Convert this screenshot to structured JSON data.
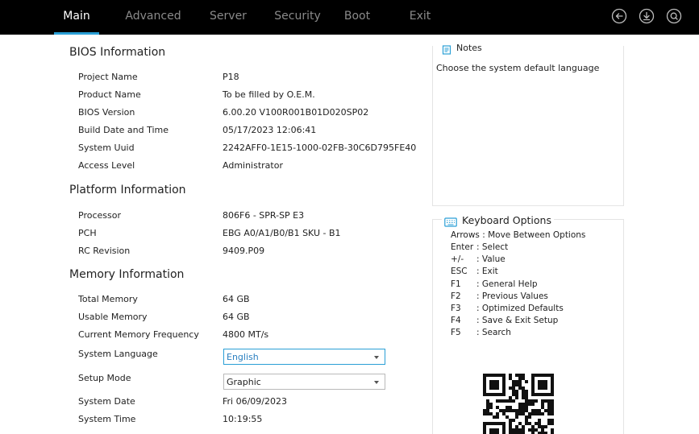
{
  "menu": {
    "tabs": [
      {
        "label": "Main",
        "active": true
      },
      {
        "label": "Advanced",
        "active": false
      },
      {
        "label": "Server",
        "active": false
      },
      {
        "label": "Security",
        "active": false
      },
      {
        "label": "Boot",
        "active": false
      },
      {
        "label": "Exit",
        "active": false
      }
    ],
    "icons": [
      "back-icon",
      "download-icon",
      "search-icon"
    ],
    "accent_color": "#2a9fd6"
  },
  "bios_info": {
    "title": "BIOS Information",
    "rows": [
      {
        "label": "Project Name",
        "value": "P18"
      },
      {
        "label": "Product Name",
        "value": "To be filled by O.E.M."
      },
      {
        "label": "BIOS Version",
        "value": "6.00.20 V100R001B01D020SP02"
      },
      {
        "label": "Build Date and Time",
        "value": "05/17/2023 12:06:41"
      },
      {
        "label": "System Uuid",
        "value": "2242AFF0-1E15-1000-02FB-30C6D795FE40"
      },
      {
        "label": "Access Level",
        "value": "Administrator"
      }
    ]
  },
  "platform_info": {
    "title": "Platform Information",
    "rows": [
      {
        "label": "Processor",
        "value": "806F6 - SPR-SP E3"
      },
      {
        "label": "PCH",
        "value": "EBG A0/A1/B0/B1 SKU - B1"
      },
      {
        "label": "RC Revision",
        "value": "9409.P09"
      }
    ]
  },
  "memory_info": {
    "title": "Memory Information",
    "rows": [
      {
        "label": "Total Memory",
        "value": "64 GB"
      },
      {
        "label": "Usable Memory",
        "value": "64 GB"
      },
      {
        "label": "Current Memory Frequency",
        "value": "4800 MT/s"
      }
    ]
  },
  "settings": {
    "system_language": {
      "label": "System Language",
      "value": "English"
    },
    "setup_mode": {
      "label": "Setup Mode",
      "value": "Graphic"
    },
    "system_date": {
      "label": "System Date",
      "value": "Fri 06/09/2023"
    },
    "system_time": {
      "label": "System Time",
      "value": "10:19:55"
    }
  },
  "notes": {
    "title": "Notes",
    "text": "Choose the system default language"
  },
  "keyboard": {
    "title": "Keyboard Options",
    "items": [
      {
        "key": "Arrows",
        "desc": ": Move Between Options"
      },
      {
        "key": "Enter",
        "desc": ": Select"
      },
      {
        "key": "+/-",
        "desc": ": Value"
      },
      {
        "key": "ESC",
        "desc": ": Exit"
      },
      {
        "key": "F1",
        "desc": ": General Help"
      },
      {
        "key": "F2",
        "desc": ": Previous Values"
      },
      {
        "key": "F3",
        "desc": ": Optimized Defaults"
      },
      {
        "key": "F4",
        "desc": ": Save & Exit Setup"
      },
      {
        "key": "F5",
        "desc": ": Search"
      }
    ]
  }
}
